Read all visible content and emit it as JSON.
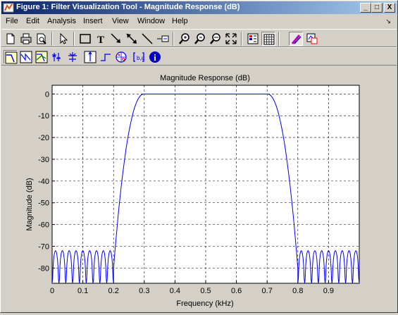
{
  "window": {
    "title": "Figure 1: Filter Visualization Tool - Magnitude Response (dB)",
    "minimize": "_",
    "maximize": "□",
    "close": "X"
  },
  "menu": {
    "items": [
      "File",
      "Edit",
      "Analysis",
      "Insert",
      "View",
      "Window",
      "Help"
    ],
    "arrow": "↘"
  },
  "toolbar1": {
    "icons": [
      "new-icon",
      "print-icon",
      "print-preview-icon",
      "arrow-pointer-icon",
      "rectangle-icon",
      "text-icon",
      "arrow-icon",
      "line-arrow-icon",
      "line-icon",
      "legend-icon",
      "zoom-in-icon",
      "zoom-out-icon",
      "zoom-x-icon",
      "zoom-fit-icon",
      "colorbar-icon",
      "grid-icon",
      "link-icon",
      "data-cursor-icon"
    ]
  },
  "toolbar2": {
    "icons": [
      "magnitude-response-icon",
      "phase-response-icon",
      "magnitude-phase-icon",
      "group-delay-icon",
      "phase-delay-icon",
      "impulse-response-icon",
      "step-response-icon",
      "pole-zero-icon",
      "filter-coefficients-icon",
      "filter-info-icon"
    ],
    "info_glyph": "i"
  },
  "colors": {
    "line": "#0000ff",
    "grid": "#000000",
    "plot_bg": "#ffffff",
    "frame_bg": "#d4d0c8"
  },
  "chart_data": {
    "type": "line",
    "title": "Magnitude Response (dB)",
    "xlabel": "Frequency (kHz)",
    "ylabel": "Magnitude (dB)",
    "xlim": [
      0,
      1
    ],
    "ylim": [
      -87,
      4
    ],
    "xticks": [
      0,
      0.1,
      0.2,
      0.3,
      0.4,
      0.5,
      0.6,
      0.7,
      0.8,
      0.9
    ],
    "xtick_labels": [
      "0",
      "0.1",
      "0.2",
      "0.3",
      "0.4",
      "0.5",
      "0.6",
      "0.7",
      "0.8",
      "0.9"
    ],
    "yticks": [
      0,
      -10,
      -20,
      -30,
      -40,
      -50,
      -60,
      -70,
      -80
    ],
    "ytick_labels": [
      "0",
      "-10",
      "-20",
      "-30",
      "-40",
      "-50",
      "-60",
      "-70",
      "-80"
    ],
    "grid": true,
    "series": [
      {
        "stopband_low": [
          0,
          0.2
        ],
        "passband": [
          0.3,
          0.7
        ],
        "stopband_high": [
          0.8,
          1.0
        ],
        "stopband_peak_db": -72,
        "passband_db": 0,
        "lobes_per_stopband": 9
      }
    ]
  }
}
